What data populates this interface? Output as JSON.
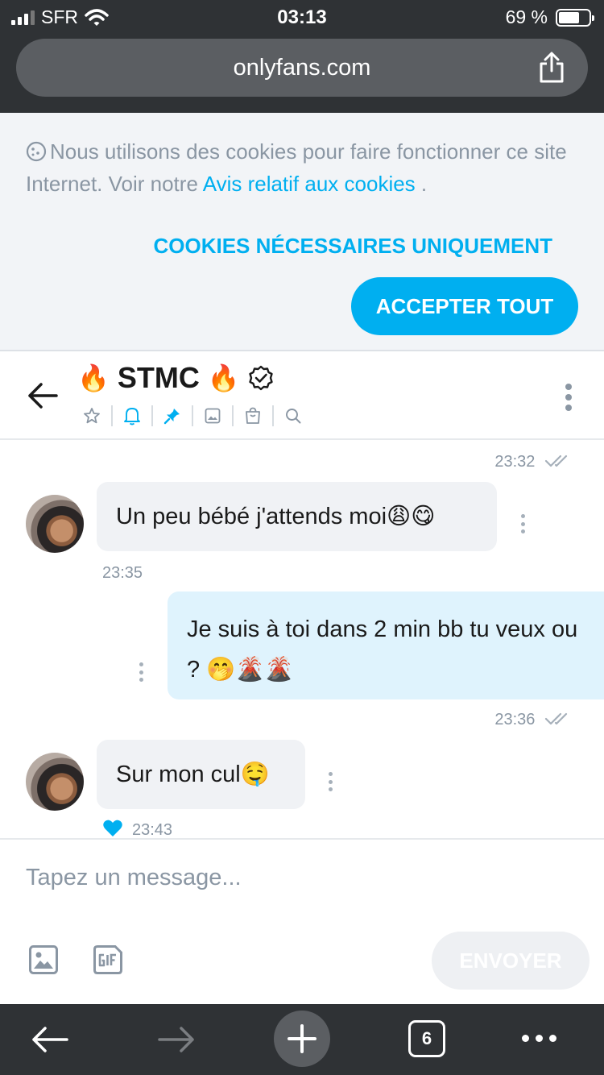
{
  "status_bar": {
    "carrier": "SFR",
    "time": "03:13",
    "battery": "69 %",
    "battery_level": 0.69
  },
  "browser": {
    "url": "onlyfans.com"
  },
  "cookie_banner": {
    "message": "Nous utilisons des cookies pour faire fonctionner ce site Internet. Voir notre ",
    "link": "Avis relatif aux cookies",
    "after_link": " .",
    "necessary_only": "COOKIES NÉCESSAIRES UNIQUEMENT",
    "accept_all": "ACCEPTER TOUT"
  },
  "chat_header": {
    "name": "STMC",
    "flame": "🔥",
    "icons": [
      "star-icon",
      "bell-icon",
      "pin-icon",
      "image-icon",
      "bag-icon",
      "search-icon"
    ]
  },
  "messages": [
    {
      "direction": "out",
      "time": "23:32",
      "read": true
    },
    {
      "direction": "in",
      "text": "Un peu bébé j'attends moi😩😋",
      "time": "23:35"
    },
    {
      "direction": "out",
      "text": "Je suis à toi dans 2 min bb tu veux ou ? 🤭🌋🌋",
      "time": "23:36",
      "read": true
    },
    {
      "direction": "in",
      "text": "Sur mon cul🤤",
      "time": "23:43",
      "liked": true
    }
  ],
  "composer": {
    "placeholder": "Tapez un message...",
    "send": "ENVOYER"
  },
  "toolbar": {
    "tab_count": "6"
  },
  "colors": {
    "accent": "#00aff0",
    "chrome": "#2f3235",
    "incoming_bubble": "#f0f2f5",
    "outgoing_bubble": "#dff3fd"
  }
}
